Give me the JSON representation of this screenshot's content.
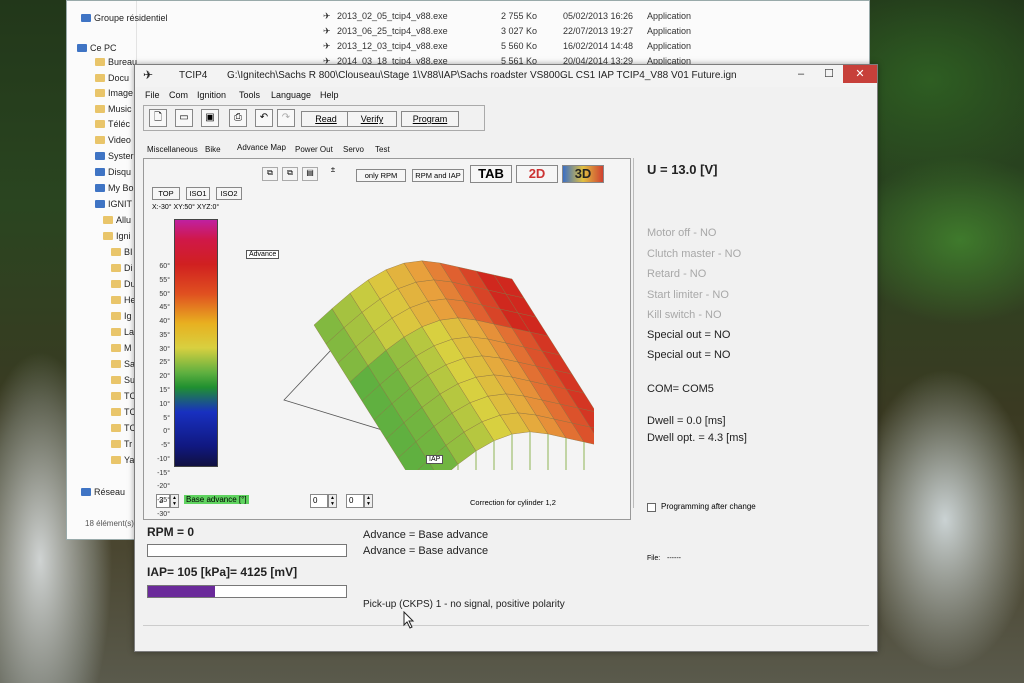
{
  "explorer": {
    "nav": [
      {
        "label": "Groupe résidentiel",
        "kind": "home"
      },
      {
        "label": "Ce PC",
        "kind": "pc"
      },
      {
        "label": "Bureau",
        "kind": "folder"
      },
      {
        "label": "Docu",
        "kind": "folder"
      },
      {
        "label": "Image",
        "kind": "folder"
      },
      {
        "label": "Music",
        "kind": "folder"
      },
      {
        "label": "Téléc",
        "kind": "folder"
      },
      {
        "label": "Video",
        "kind": "folder"
      },
      {
        "label": "Syster",
        "kind": "drive"
      },
      {
        "label": "Disqu",
        "kind": "drive"
      },
      {
        "label": "My Bo",
        "kind": "drive"
      },
      {
        "label": "IGNIT",
        "kind": "drive"
      },
      {
        "label": "Allu",
        "kind": "folder"
      },
      {
        "label": "Igni",
        "kind": "folder"
      },
      {
        "label": "BI",
        "kind": "folder"
      },
      {
        "label": "Di",
        "kind": "folder"
      },
      {
        "label": "Du",
        "kind": "folder"
      },
      {
        "label": "He",
        "kind": "folder"
      },
      {
        "label": "Ig",
        "kind": "folder"
      },
      {
        "label": "La",
        "kind": "folder"
      },
      {
        "label": "M",
        "kind": "folder"
      },
      {
        "label": "Sa",
        "kind": "folder"
      },
      {
        "label": "Su",
        "kind": "folder"
      },
      {
        "label": "TC",
        "kind": "folder"
      },
      {
        "label": "TC",
        "kind": "folder"
      },
      {
        "label": "TC",
        "kind": "folder"
      },
      {
        "label": "Tr",
        "kind": "folder"
      },
      {
        "label": "Ya",
        "kind": "folder"
      },
      {
        "label": "Réseau",
        "kind": "network"
      }
    ],
    "item_count": "18 élément(s)",
    "files": [
      {
        "name": "2013_02_05_tcip4_v88.exe",
        "size": "2 755 Ko",
        "date": "05/02/2013 16:26",
        "type": "Application"
      },
      {
        "name": "2013_06_25_tcip4_v88.exe",
        "size": "3 027 Ko",
        "date": "22/07/2013 19:27",
        "type": "Application"
      },
      {
        "name": "2013_12_03_tcip4_v88.exe",
        "size": "5 560 Ko",
        "date": "16/02/2014 14:48",
        "type": "Application"
      },
      {
        "name": "2014_03_18_tcip4_v88.exe",
        "size": "5 561 Ko",
        "date": "20/04/2014 13:29",
        "type": "Application"
      }
    ]
  },
  "app": {
    "title": "TCIP4",
    "path": "G:\\Ignitech\\Sachs R 800\\Clouseau\\Stage 1\\V88\\IAP\\Sachs roadster VS800GL CS1 IAP TCIP4_V88 V01 Future.ign",
    "menu": [
      "File",
      "Com",
      "Ignition",
      "Tools",
      "Language",
      "Help"
    ],
    "toolbar": {
      "read": "Read",
      "verify": "Verify",
      "program": "Program"
    },
    "tabs": [
      "Miscellaneous",
      "Bike",
      "Advance Map",
      "Power Out",
      "Servo",
      "Test"
    ],
    "active_tab": "Advance Map",
    "map": {
      "only_rpm": "only RPM",
      "rpm_and_iap": "RPM and IAP",
      "tab": "TAB",
      "two_d": "2D",
      "three_d": "3D",
      "view_top": "TOP",
      "view_iso1": "ISO1",
      "view_iso2": "ISO2",
      "angles": "X:-30°  XY:50°  XYZ:0°",
      "axis_advance": "Advance",
      "axis_iap": "IAP",
      "scale": [
        "60°",
        "55°",
        "50°",
        "45°",
        "40°",
        "35°",
        "30°",
        "25°",
        "20°",
        "15°",
        "10°",
        "5°",
        "0°",
        "-5°",
        "-10°",
        "-15°",
        "-20°",
        "-25°",
        "-30°"
      ],
      "map_index": "3",
      "map_name": "Base advance [°]",
      "correction_a": "0",
      "correction_b": "0",
      "correction_label": "Correction for cylinder 1,2"
    },
    "status": {
      "voltage": "U = 13.0 [V]",
      "flags_inactive": [
        "Motor off - NO",
        "Clutch master - NO",
        "Retard - NO",
        "Start limiter - NO",
        "Kill switch - NO"
      ],
      "flags_active": [
        "Special out = NO",
        "Special out = NO"
      ],
      "com": "COM= COM5",
      "dwell": "Dwell = 0.0 [ms]",
      "dwell_opt": "Dwell opt. = 4.3 [ms]",
      "programming_after_change": "Programming after change",
      "file_label": "File:",
      "file_value": "------"
    },
    "bottom": {
      "rpm": "RPM = 0",
      "rpm_fraction": 0,
      "iap": "IAP= 105 [kPa]= 4125 [mV]",
      "iap_fraction": 0.34,
      "advance1": "Advance = Base advance",
      "advance2": "Advance = Base advance",
      "pickup": "Pick-up (CKPS) 1 - no signal, positive polarity"
    }
  }
}
